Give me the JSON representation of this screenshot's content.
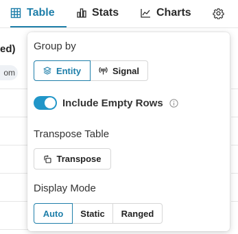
{
  "tabs": {
    "table": "Table",
    "stats": "Stats",
    "charts": "Charts"
  },
  "background": {
    "header_fragment": "ed)",
    "chip_fragment": "om"
  },
  "popover": {
    "group_by": {
      "label": "Group by",
      "options": [
        "Entity",
        "Signal"
      ],
      "selected": "Entity"
    },
    "include_empty_rows": {
      "label": "Include Empty Rows",
      "enabled": true
    },
    "transpose": {
      "label": "Transpose Table",
      "button": "Transpose"
    },
    "display_mode": {
      "label": "Display Mode",
      "options": [
        "Auto",
        "Static",
        "Ranged"
      ],
      "selected": "Auto"
    }
  },
  "colors": {
    "accent": "#1d7ea9",
    "toggle_on": "#2196c8"
  },
  "icons": {
    "table_tab": "table-grid-icon",
    "stats_tab": "bar-chart-icon",
    "charts_tab": "line-chart-icon",
    "settings": "gear-icon",
    "entity": "layers-icon",
    "signal": "broadcast-icon",
    "transpose": "transpose-icon",
    "info": "info-icon"
  }
}
